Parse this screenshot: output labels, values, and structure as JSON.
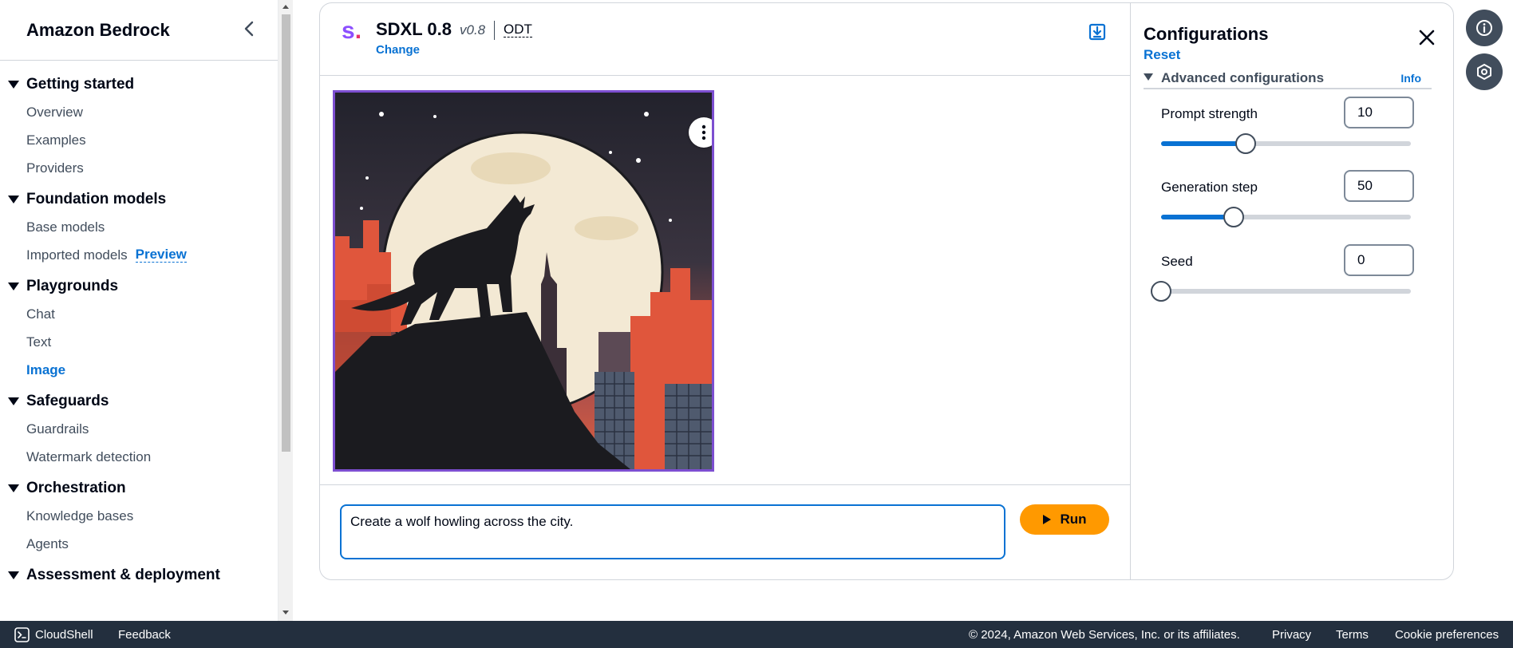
{
  "sidebar": {
    "title": "Amazon Bedrock",
    "sections": [
      {
        "label": "Getting started",
        "items": [
          "Overview",
          "Examples",
          "Providers"
        ]
      },
      {
        "label": "Foundation models",
        "items": [
          "Base models",
          "Imported models"
        ],
        "badge": "Preview"
      },
      {
        "label": "Playgrounds",
        "items": [
          "Chat",
          "Text",
          "Image"
        ],
        "active": "Image"
      },
      {
        "label": "Safeguards",
        "items": [
          "Guardrails",
          "Watermark detection"
        ]
      },
      {
        "label": "Orchestration",
        "items": [
          "Knowledge bases",
          "Agents"
        ]
      },
      {
        "label": "Assessment & deployment",
        "items": []
      }
    ]
  },
  "model": {
    "logo_letter": "s",
    "logo_dot": ".",
    "name": "SDXL 0.8",
    "version": "v0.8",
    "tag": "ODT",
    "change_label": "Change"
  },
  "prompt": {
    "value": "Create a wolf howling across the city.",
    "run_label": "Run"
  },
  "config": {
    "title": "Configurations",
    "reset_label": "Reset",
    "advanced_label": "Advanced configurations",
    "info_label": "Info",
    "params": [
      {
        "label": "Prompt strength",
        "value": "10",
        "fraction": 0.34
      },
      {
        "label": "Generation step",
        "value": "50",
        "fraction": 0.29
      },
      {
        "label": "Seed",
        "value": "0",
        "fraction": 0.0
      }
    ]
  },
  "footer": {
    "cloudshell": "CloudShell",
    "feedback": "Feedback",
    "copyright": "© 2024, Amazon Web Services, Inc. or its affiliates.",
    "privacy": "Privacy",
    "terms": "Terms",
    "cookies": "Cookie preferences"
  },
  "colors": {
    "accent": "#0972d3",
    "run_button": "#ff9900",
    "image_border": "#7d4fd1",
    "footer_bg": "#232f3e"
  }
}
